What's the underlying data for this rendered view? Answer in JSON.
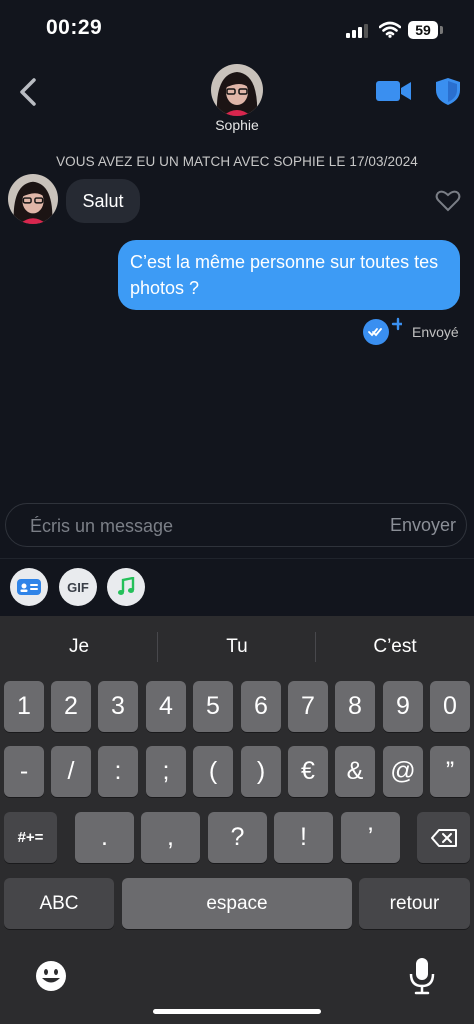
{
  "status_bar": {
    "time": "00:29",
    "battery": "59"
  },
  "header": {
    "contact_name": "Sophie"
  },
  "chat": {
    "match_note": "VOUS AVEZ EU UN MATCH AVEC SOPHIE LE 17/03/2024",
    "messages": [
      {
        "from": "Sophie",
        "text": "Salut"
      },
      {
        "from": "me",
        "text": "C’est la même personne sur toutes tes photos ?"
      }
    ],
    "sent_status": "Envoyé"
  },
  "composer": {
    "placeholder": "Écris un message",
    "send_label": "Envoyer"
  },
  "toolbar": {
    "gif_label": "GIF"
  },
  "keyboard": {
    "suggestions": [
      "Je",
      "Tu",
      "C’est"
    ],
    "row1": [
      "1",
      "2",
      "3",
      "4",
      "5",
      "6",
      "7",
      "8",
      "9",
      "0"
    ],
    "row2": [
      "-",
      "/",
      ":",
      ";",
      "(",
      ")",
      "€",
      "&",
      "@",
      "”"
    ],
    "row3_left": "#+=",
    "row3": [
      ".",
      ",",
      "?",
      "!",
      "’"
    ],
    "abc": "ABC",
    "space": "espace",
    "return": "retour"
  },
  "colors": {
    "accent": "#3d9bf5",
    "background": "#12151d",
    "keyboard": "#2c2c2e"
  }
}
